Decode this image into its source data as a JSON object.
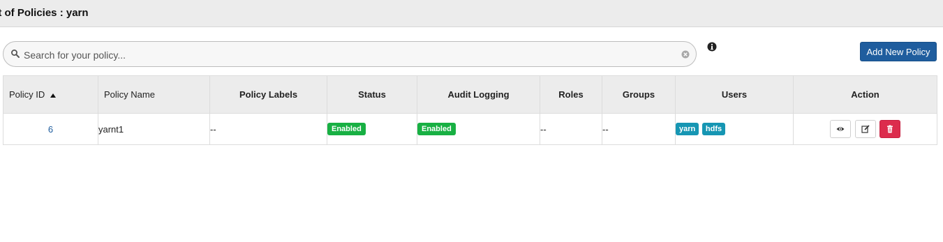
{
  "header": {
    "title": "st of Policies : yarn"
  },
  "search": {
    "placeholder": "Search for your policy..."
  },
  "toolbar": {
    "add_label": "Add New Policy"
  },
  "table": {
    "columns": [
      "Policy ID",
      "Policy Name",
      "Policy Labels",
      "Status",
      "Audit Logging",
      "Roles",
      "Groups",
      "Users",
      "Action"
    ],
    "rows": [
      {
        "policy_id": "6",
        "policy_name": "yarnt1",
        "policy_labels": "--",
        "status": "Enabled",
        "audit_logging": "Enabled",
        "roles": "--",
        "groups": "--",
        "users": [
          "yarn",
          "hdfs"
        ]
      }
    ]
  },
  "icons": {
    "search": "search-icon",
    "clear": "clear-circle-icon",
    "info": "info-circle-icon",
    "sort": "sort-asc-icon",
    "view": "eye-icon",
    "edit": "edit-icon",
    "delete": "trash-icon"
  },
  "colors": {
    "primary": "#1f5d9e",
    "success": "#18b043",
    "info": "#1696b3",
    "danger": "#dc2c4d",
    "header_bg": "#ececec"
  }
}
